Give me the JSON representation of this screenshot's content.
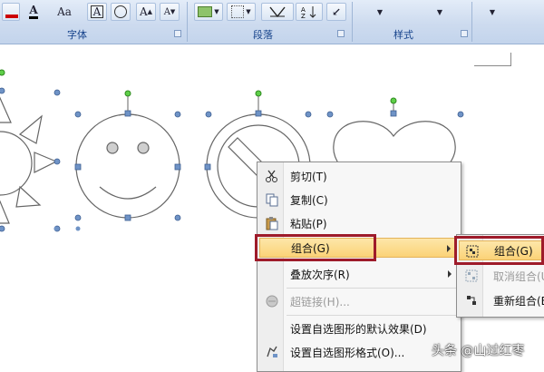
{
  "ribbon": {
    "groups": [
      {
        "label": "字体"
      },
      {
        "label": "段落"
      },
      {
        "label": "样式"
      }
    ],
    "font_buttons": [
      "A",
      "Aa",
      "A",
      "A",
      "A"
    ],
    "colors": {
      "accent": "#15428b",
      "ribbon_bg": "#cddbef"
    }
  },
  "context_menu": {
    "items": [
      {
        "label": "剪切(T)",
        "icon": "scissors-icon",
        "enabled": true
      },
      {
        "label": "复制(C)",
        "icon": "copy-icon",
        "enabled": true
      },
      {
        "label": "粘贴(P)",
        "icon": "paste-icon",
        "enabled": true
      },
      {
        "label": "组合(G)",
        "icon": "",
        "enabled": true,
        "highlighted": true,
        "submenu": true
      },
      {
        "label": "叠放次序(R)",
        "icon": "",
        "enabled": true,
        "submenu": true
      },
      {
        "label": "超链接(H)...",
        "icon": "hyperlink-icon",
        "enabled": false
      },
      {
        "label": "设置自选图形的默认效果(D)",
        "icon": "",
        "enabled": true
      },
      {
        "label": "设置自选图形格式(O)...",
        "icon": "format-shape-icon",
        "enabled": true
      }
    ],
    "highlight_color": "#9e1b2a"
  },
  "submenu": {
    "items": [
      {
        "label": "组合(G)",
        "icon": "group-icon",
        "enabled": true,
        "highlighted": true
      },
      {
        "label": "取消组合(U)",
        "icon": "ungroup-icon",
        "enabled": false
      },
      {
        "label": "重新组合(E)",
        "icon": "regroup-icon",
        "enabled": true
      }
    ]
  },
  "watermark": "头条 @山过红枣"
}
